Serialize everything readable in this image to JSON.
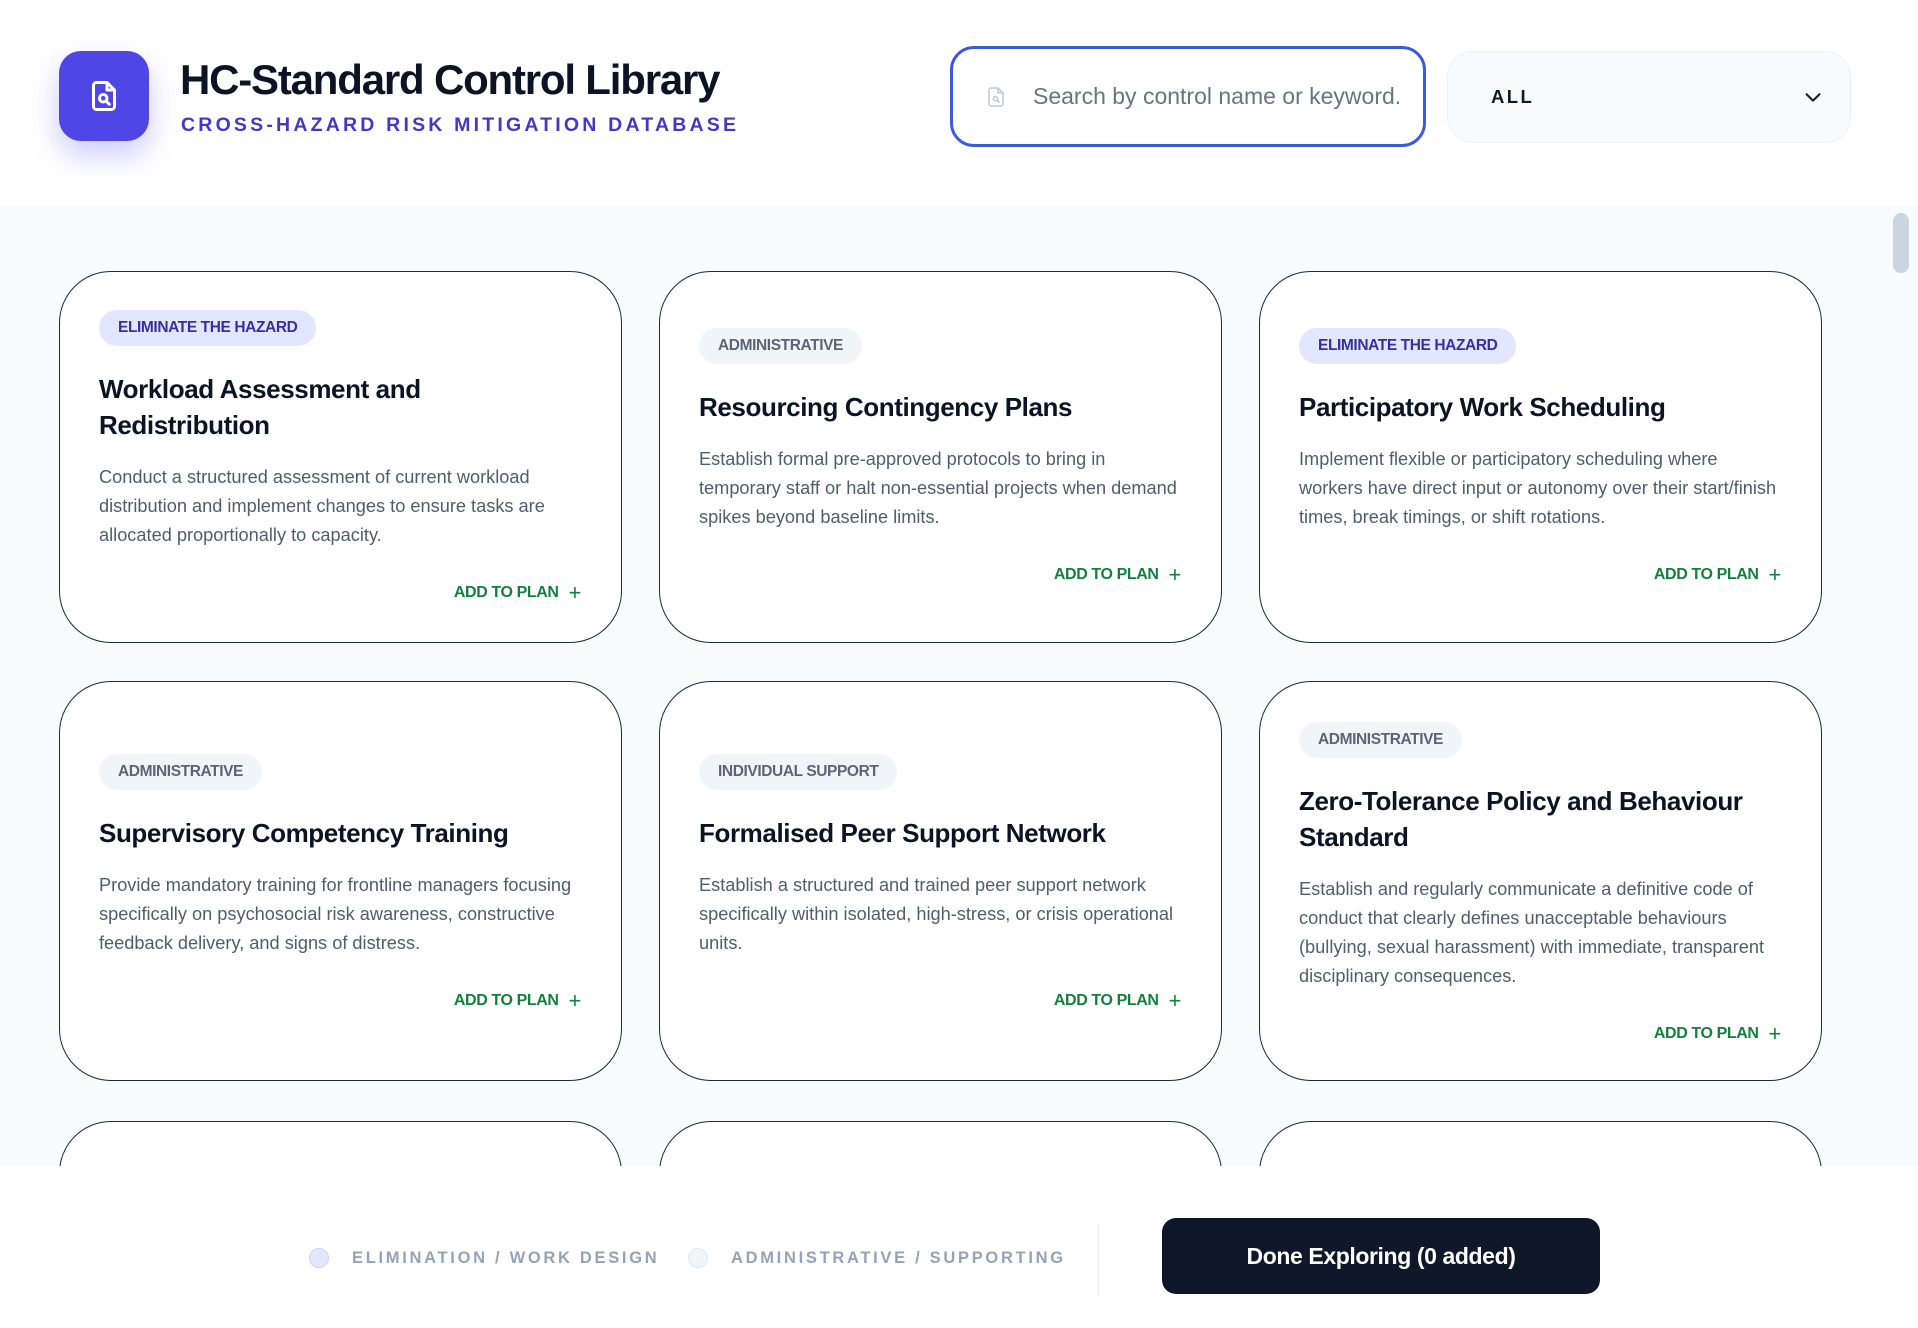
{
  "header": {
    "logo_icon": "document-search-icon",
    "title": "HC-Standard Control Library",
    "subtitle": "CROSS-HAZARD RISK MITIGATION DATABASE"
  },
  "search": {
    "icon": "document-search-icon",
    "placeholder": "Search by control name or keyword...",
    "value": ""
  },
  "filter": {
    "selected": "ALL",
    "icon": "chevron-down-icon"
  },
  "cards": [
    {
      "badge": "ELIMINATE THE HAZARD",
      "badge_type": "elimination",
      "title": "Workload Assessment and Redistribution",
      "description": "Conduct a structured assessment of current workload distribution and implement changes to ensure tasks are allocated proportionally to capacity.",
      "action": "ADD TO PLAN"
    },
    {
      "badge": "ADMINISTRATIVE",
      "badge_type": "administrative",
      "title": "Resourcing Contingency Plans",
      "description": "Establish formal pre-approved protocols to bring in temporary staff or halt non-essential projects when demand spikes beyond baseline limits.",
      "action": "ADD TO PLAN"
    },
    {
      "badge": "ELIMINATE THE HAZARD",
      "badge_type": "elimination",
      "title": "Participatory Work Scheduling",
      "description": "Implement flexible or participatory scheduling where workers have direct input or autonomy over their start/finish times, break timings, or shift rotations.",
      "action": "ADD TO PLAN"
    },
    {
      "badge": "ADMINISTRATIVE",
      "badge_type": "administrative",
      "title": "Supervisory Competency Training",
      "description": "Provide mandatory training for frontline managers focusing specifically on psychosocial risk awareness, constructive feedback delivery, and signs of distress.",
      "action": "ADD TO PLAN"
    },
    {
      "badge": "INDIVIDUAL SUPPORT",
      "badge_type": "administrative",
      "title": "Formalised Peer Support Network",
      "description": "Establish a structured and trained peer support network specifically within isolated, high-stress, or crisis operational units.",
      "action": "ADD TO PLAN"
    },
    {
      "badge": "ADMINISTRATIVE",
      "badge_type": "administrative",
      "title": "Zero-Tolerance Policy and Behaviour Standard",
      "description": "Establish and regularly communicate a definitive code of conduct that clearly defines unacceptable behaviours (bullying, sexual harassment) with immediate, transparent disciplinary consequences.",
      "action": "ADD TO PLAN"
    }
  ],
  "legend": [
    {
      "label": "ELIMINATION / WORK DESIGN",
      "color": "#e0e7ff"
    },
    {
      "label": "ADMINISTRATIVE / SUPPORTING",
      "color": "#f1f5f9"
    }
  ],
  "footer": {
    "done_label": "Done Exploring (0 added)"
  },
  "colors": {
    "accent": "#4f46e5",
    "search_border": "#3b5bdb",
    "action_green": "#15803d",
    "dark_button": "#0f172a"
  }
}
